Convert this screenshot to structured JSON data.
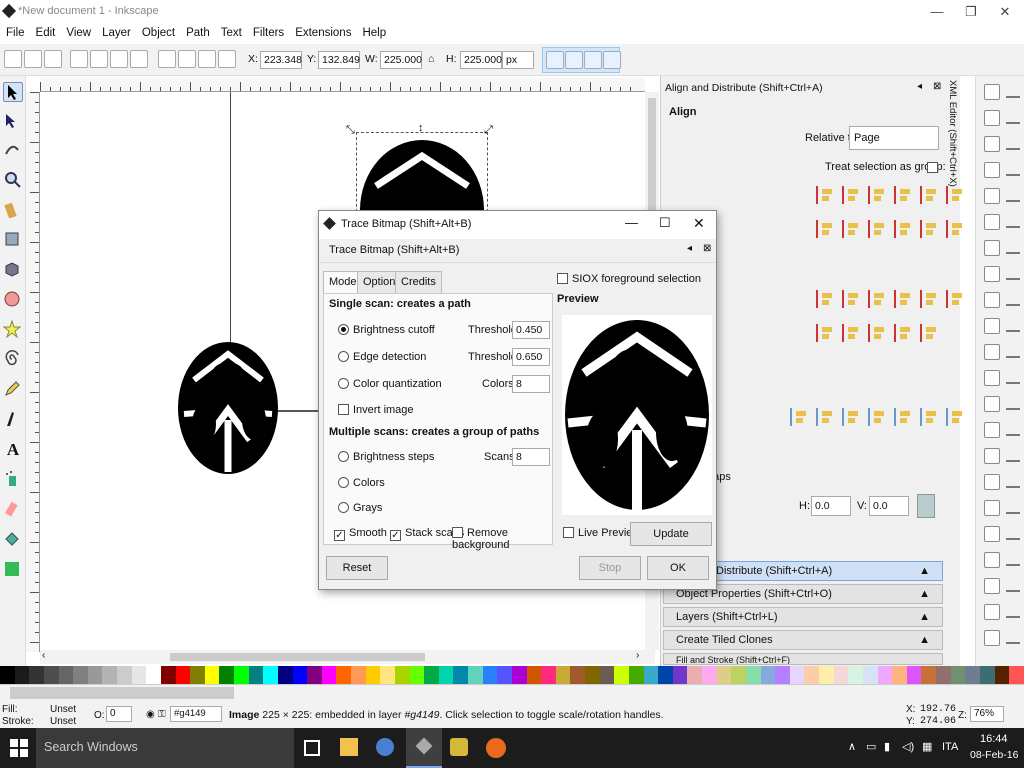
{
  "window": {
    "title": "*New document 1 - Inkscape",
    "min": "—",
    "max": "❐",
    "close": "✕"
  },
  "menu": [
    "File",
    "Edit",
    "View",
    "Layer",
    "Object",
    "Path",
    "Text",
    "Filters",
    "Extensions",
    "Help"
  ],
  "toolbar": {
    "x_label": "X:",
    "x": "223.348",
    "y_label": "Y:",
    "y": "132.849",
    "w_label": "W:",
    "w": "225.000",
    "h_label": "H:",
    "h": "225.000",
    "unit": "px"
  },
  "align_panel": {
    "title": "Align and Distribute (Shift+Ctrl+A)",
    "section": "Align",
    "relative_to_label": "Relative to:",
    "relative_to_value": "Page",
    "treat_label": "Treat selection as group:",
    "overlaps_label": "rlaps",
    "h_label": "H:",
    "h_value": "0.0",
    "v_label": "V:",
    "v_value": "0.0",
    "docks": [
      "Distribute (Shift+Ctrl+A)",
      "Object Properties (Shift+Ctrl+O)",
      "Layers (Shift+Ctrl+L)",
      "Create Tiled Clones",
      "Fill and Stroke (Shift+Ctrl+F)"
    ],
    "xml_tab": "XML Editor (Shift+Ctrl+X)"
  },
  "dialog": {
    "title": "Trace Bitmap (Shift+Alt+B)",
    "subtitle": "Trace Bitmap (Shift+Alt+B)",
    "tabs": [
      "Mode",
      "Options",
      "Credits"
    ],
    "single_heading": "Single scan: creates a path",
    "brightness": "Brightness cutoff",
    "edge": "Edge detection",
    "quant": "Color quantization",
    "invert": "Invert image",
    "threshold_label": "Threshold:",
    "threshold1": "0.450",
    "threshold2": "0.650",
    "colors_label": "Colors:",
    "colors": "8",
    "multi_heading": "Multiple scans: creates a group of paths",
    "steps": "Brightness steps",
    "scans_label": "Scans:",
    "scans": "8",
    "colors_opt": "Colors",
    "grays": "Grays",
    "smooth": "Smooth",
    "stack": "Stack scans",
    "remove_bg": "Remove background",
    "siox": "SIOX foreground selection",
    "preview_label": "Preview",
    "live_preview": "Live Preview",
    "update": "Update",
    "reset": "Reset",
    "stop": "Stop",
    "ok": "OK"
  },
  "status": {
    "fill_label": "Fill:",
    "fill": "Unset",
    "stroke_label": "Stroke:",
    "stroke": "Unset",
    "opacity_label": "O:",
    "opacity": "0",
    "layer": "#g4149",
    "message_bold": "Image",
    "message": " 225 × 225: embedded in layer ",
    "message_layer": "#g4149",
    "message_tail": ". Click selection to toggle scale/rotation handles.",
    "x_label": "X:",
    "x": "192.76",
    "y_label": "Y:",
    "y": "274.06",
    "z_label": "Z:",
    "zoom": "76%"
  },
  "taskbar": {
    "search": "Search Windows",
    "lang": "ITA",
    "time": "16:44",
    "date": "08-Feb-16"
  },
  "palette_colors": [
    "#000000",
    "#1a1a1a",
    "#333333",
    "#4d4d4d",
    "#666666",
    "#808080",
    "#999999",
    "#b3b3b3",
    "#cccccc",
    "#e6e6e6",
    "#ffffff",
    "#800000",
    "#ff0000",
    "#808000",
    "#ffff00",
    "#008000",
    "#00ff00",
    "#008080",
    "#00ffff",
    "#000080",
    "#0000ff",
    "#800080",
    "#ff00ff",
    "#ff6600",
    "#ff9955",
    "#ffcc00",
    "#ffe680",
    "#aad400",
    "#66ff00",
    "#00aa44",
    "#00d4aa",
    "#0088aa",
    "#5fd3bc",
    "#2a7fff",
    "#5555ff",
    "#aa00d4",
    "#d45500",
    "#ff2a7f",
    "#c8ab37",
    "#a05a2c",
    "#806600",
    "#6c5d53",
    "#ccff00",
    "#44aa00",
    "#37abc8",
    "#0044aa",
    "#7137c8",
    "#e9afaf",
    "#ffaaee",
    "#decd87",
    "#bcd35f",
    "#87deaa",
    "#87aade",
    "#b380ff",
    "#e5d5ff",
    "#ffccaa",
    "#ffeeaa",
    "#f4d7d7",
    "#d7f4e3",
    "#d7e3f4",
    "#eeaaff",
    "#ffb380",
    "#dd55ff",
    "#c87137",
    "#916f6f",
    "#6f916f",
    "#6f7c91",
    "#3c6e71",
    "#552200",
    "#ff5555"
  ]
}
